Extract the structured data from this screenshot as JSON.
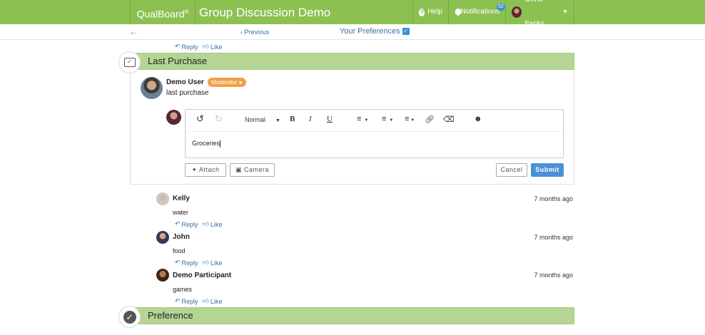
{
  "header": {
    "brand": "QualBoard",
    "brand_mark": "®",
    "title": "Group Discussion Demo",
    "help_label": "Help",
    "notifications_label": "Notifications",
    "notifications_count": "52",
    "user_name": "Olivia Banks"
  },
  "subnav": {
    "previous_label": "Previous",
    "preferences_label": "Your Preferences"
  },
  "actions": {
    "reply": "Reply",
    "like": "Like"
  },
  "sections": [
    {
      "title": "Last Purchase",
      "icon": "comment-icon"
    },
    {
      "title": "Preference",
      "icon": "check-circle-icon"
    }
  ],
  "moderator_post": {
    "author": "Demo User",
    "badge": "Moderator",
    "text": "last purchase"
  },
  "editor": {
    "format_label": "Normal",
    "content": "Groceries",
    "attach_label": "Attach",
    "camera_label": "Camera",
    "cancel_label": "Cancel",
    "submit_label": "Submit"
  },
  "comments": [
    {
      "author": "Kelly",
      "time": "7 months ago",
      "text": "water"
    },
    {
      "author": "John",
      "time": "7 months ago",
      "text": "food"
    },
    {
      "author": "Demo Participant",
      "time": "7 months ago",
      "text": "games"
    }
  ],
  "colors": {
    "header_green": "#8cc152",
    "section_green": "#b5d594",
    "link_blue": "#3a6ea5",
    "submit_blue": "#4a90d9",
    "moderator_orange": "#f0a046"
  }
}
